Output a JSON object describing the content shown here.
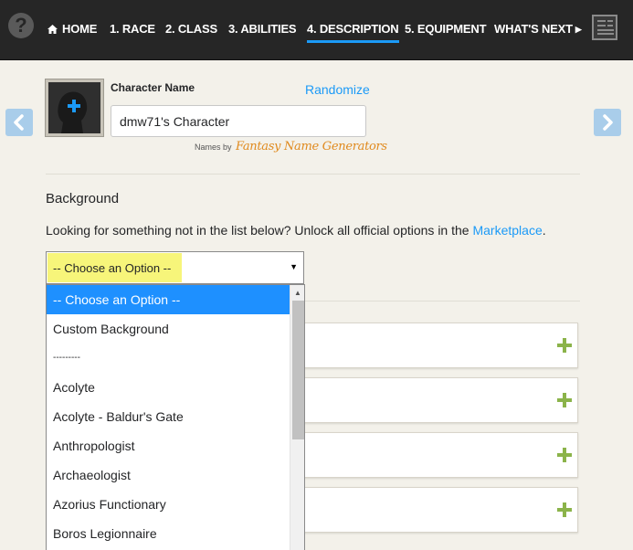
{
  "nav": {
    "items": [
      {
        "label": "HOME"
      },
      {
        "label": "1. RACE"
      },
      {
        "label": "2. CLASS"
      },
      {
        "label": "3. ABILITIES"
      },
      {
        "label": "4. DESCRIPTION",
        "active": true
      },
      {
        "label": "5. EQUIPMENT"
      },
      {
        "label": "WHAT'S NEXT"
      }
    ],
    "help_icon": "question-mark-icon",
    "sheet_icon": "character-sheet-icon",
    "accent_color": "#1b9af7"
  },
  "character": {
    "name_label": "Character Name",
    "randomize_label": "Randomize",
    "name_value": "dmw71's Character",
    "names_by": "Names by",
    "generator_logo": "Fantasy Name Generators"
  },
  "background": {
    "title": "Background",
    "helper_text": "Looking for something not in the list below? Unlock all official options in the ",
    "helper_link": "Marketplace",
    "helper_suffix": ".",
    "selected_value": "-- Choose an Option --",
    "options": [
      "-- Choose an Option --",
      "Custom Background",
      "---------",
      "Acolyte",
      "Acolyte - Baldur's Gate",
      "Anthropologist",
      "Archaeologist",
      "Azorius Functionary",
      "Boros Legionnaire"
    ]
  },
  "cards": [
    {
      "icon": "plus-icon"
    },
    {
      "icon": "plus-icon"
    },
    {
      "icon": "plus-icon"
    },
    {
      "icon": "plus-icon"
    }
  ]
}
